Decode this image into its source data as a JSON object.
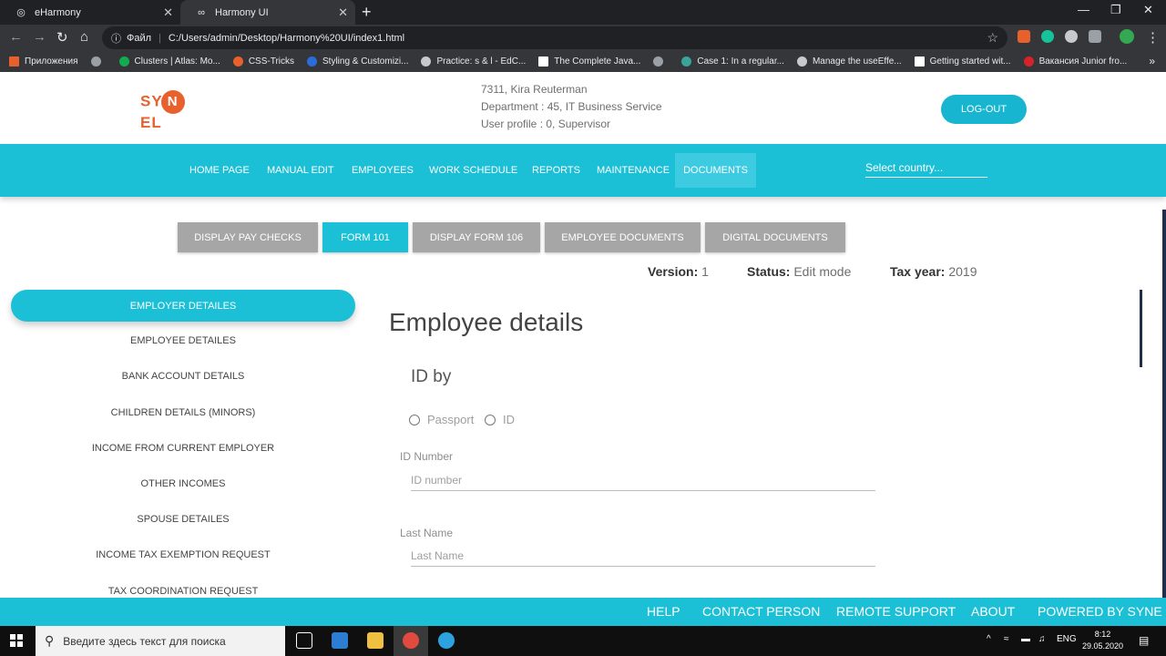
{
  "browser": {
    "tabs": [
      {
        "title": "eHarmony",
        "icon": "globe-icon"
      },
      {
        "title": "Harmony UI",
        "icon": "glasses-icon"
      }
    ],
    "url_proto": "Файл",
    "url": "C:/Users/admin/Desktop/Harmony%20UI/index1.html",
    "bookmarks": [
      {
        "label": "Приложения",
        "color": "#e8612c"
      },
      {
        "label": "",
        "color": "#9aa0a6"
      },
      {
        "label": "Clusters | Atlas: Mo...",
        "color": "#13aa52"
      },
      {
        "label": "CSS-Tricks",
        "color": "#e8612c"
      },
      {
        "label": "Styling & Customizi...",
        "color": "#2b6cd9"
      },
      {
        "label": "Practice: s & l - EdC...",
        "color": "#c7c9cc"
      },
      {
        "label": "The Complete Java...",
        "color": "#ffffff"
      },
      {
        "label": "",
        "color": "#9aa0a6"
      },
      {
        "label": "Case 1: In a regular...",
        "color": "#3aa39a"
      },
      {
        "label": "Manage the useEffe...",
        "color": "#c7c9cc"
      },
      {
        "label": "Getting started wit...",
        "color": "#ffffff"
      },
      {
        "label": "Вакансия Junior fro...",
        "color": "#d6232b"
      }
    ]
  },
  "header": {
    "logo_text_left": "SY",
    "logo_text_circle": "N",
    "logo_text_right": "EL",
    "user_line1": "7311, Kira Reuterman",
    "user_line2": "Department : 45, IT Business Service",
    "user_line3": "User profile : 0, Supervisor",
    "logout_label": "LOG-OUT"
  },
  "nav": {
    "items": [
      "HOME PAGE",
      "MANUAL EDIT",
      "EMPLOYEES",
      "WORK SCHEDULE",
      "REPORTS",
      "MAINTENANCE",
      "DOCUMENTS"
    ],
    "active": "DOCUMENTS",
    "country_placeholder": "Select country..."
  },
  "subtabs": [
    "DISPLAY PAY CHECKS",
    "FORM 101",
    "DISPLAY FORM 106",
    "EMPLOYEE DOCUMENTS",
    "DIGITAL DOCUMENTS"
  ],
  "meta": {
    "version_label": "Version:",
    "version": "1",
    "status_label": "Status:",
    "status": "Edit mode",
    "taxyear_label": "Tax year:",
    "taxyear": "2019"
  },
  "sidebar": {
    "items": [
      "EMPLOYER DETAILES",
      "EMPLOYEE DETAILES",
      "BANK ACCOUNT DETAILS",
      "CHILDREN DETAILS (MINORS)",
      "INCOME FROM CURRENT EMPLOYER",
      "OTHER INCOMES",
      "SPOUSE DETAILES",
      "INCOME TAX EXEMPTION REQUEST",
      "TAX COORDINATION REQUEST"
    ]
  },
  "form": {
    "title": "Employee details",
    "id_by": "ID by",
    "radio_passport": "Passport",
    "radio_id": "ID",
    "id_label": "ID Number",
    "id_placeholder": "ID number",
    "lastname_label": "Last Name",
    "lastname_placeholder": "Last Name"
  },
  "footer": {
    "links": [
      "HELP",
      "CONTACT PERSON",
      "REMOTE SUPPORT",
      "ABOUT",
      "POWERED BY SYNE"
    ]
  },
  "taskbar": {
    "search_placeholder": "Введите здесь текст для поиска",
    "lang": "ENG",
    "time": "8:12",
    "date": "29.05.2020"
  },
  "colors": {
    "accent": "#1bbfd6",
    "brand": "#e8612c"
  }
}
